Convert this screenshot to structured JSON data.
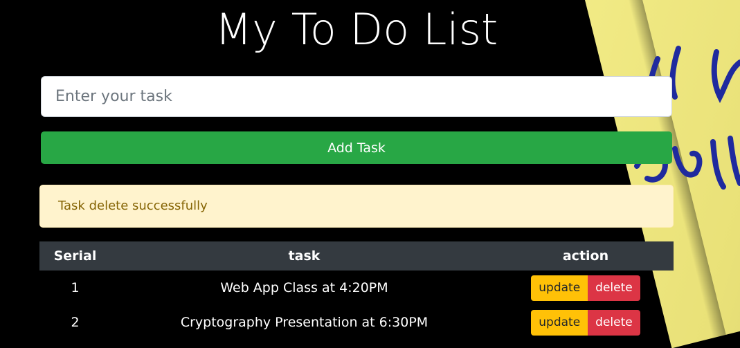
{
  "page": {
    "title": "My To Do List"
  },
  "form": {
    "task_placeholder": "Enter your task",
    "add_label": "Add Task"
  },
  "alert": {
    "message": "Task delete successfully"
  },
  "table": {
    "headers": [
      "Serial",
      "task",
      "action"
    ],
    "rows": [
      {
        "serial": "1",
        "task": "Web App Class at 4:20PM",
        "update": "update",
        "delete": "delete"
      },
      {
        "serial": "2",
        "task": "Cryptography Presentation at 6:30PM",
        "update": "update",
        "delete": "delete"
      }
    ]
  },
  "colors": {
    "background": "#000000",
    "success": "#28a745",
    "warning": "#ffc107",
    "danger": "#dc3545",
    "alert_bg": "#fff3cd",
    "table_header": "#343a40"
  }
}
